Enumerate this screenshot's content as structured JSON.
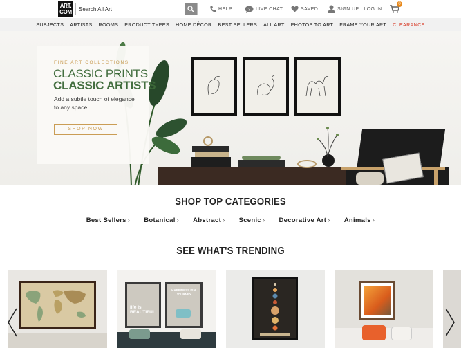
{
  "header": {
    "logo_line1": "ART.",
    "logo_line2": "COM",
    "search_placeholder": "Search All Art",
    "help_label": "HELP",
    "live_chat_label": "LIVE CHAT",
    "saved_label": "SAVED",
    "signin_label": "SIGN UP | LOG IN",
    "cart_count": "0"
  },
  "nav": {
    "items": [
      "SUBJECTS",
      "ARTISTS",
      "ROOMS",
      "PRODUCT TYPES",
      "HOME DÉCOR",
      "BEST SELLERS",
      "ALL ART",
      "PHOTOS TO ART",
      "FRAME YOUR ART",
      "CLEARANCE"
    ]
  },
  "hero": {
    "eyebrow": "FINE ART COLLECTIONS",
    "title_line1": "CLASSIC PRINTS",
    "title_line2": "CLASSIC ARTISTS",
    "subtitle": "Add a subtle touch of elegance to any space.",
    "cta": "SHOP NOW"
  },
  "categories": {
    "title": "SHOP TOP CATEGORIES",
    "items": [
      "Best Sellers",
      "Botanical",
      "Abstract",
      "Scenic",
      "Decorative Art",
      "Animals"
    ]
  },
  "trending": {
    "title": "SEE WHAT'S TRENDING",
    "products": [
      {
        "name": "world-map-print",
        "art_text": ""
      },
      {
        "name": "life-is-beautiful-print",
        "art_text": "life is BEAUTIFUL",
        "art_text2": "HAPPINESS IS A JOURNEY"
      },
      {
        "name": "solar-system-print",
        "art_text": ""
      },
      {
        "name": "flaming-june-print",
        "art_text": ""
      }
    ]
  },
  "colors": {
    "accent_green": "#3d6a39",
    "accent_gold": "#c99a4f",
    "clearance_red": "#d9402d",
    "cart_badge": "#e8891c"
  }
}
